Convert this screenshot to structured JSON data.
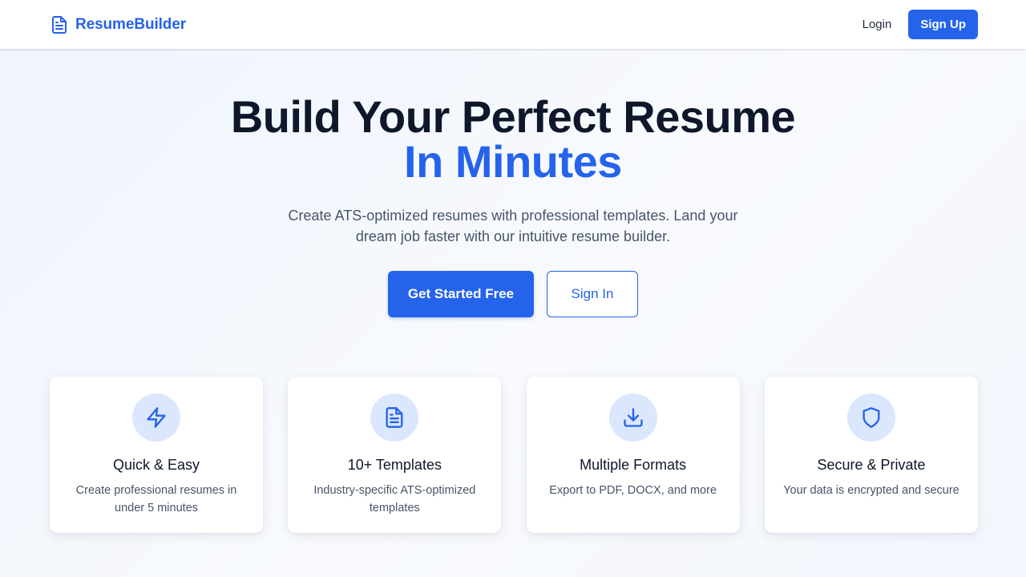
{
  "header": {
    "brand_name": "ResumeBuilder",
    "brand_icon": "document-icon",
    "login_label": "Login",
    "signup_label": "Sign Up"
  },
  "hero": {
    "title_line1": "Build Your Perfect Resume",
    "title_line2": "In Minutes",
    "subtitle": "Create ATS-optimized resumes with professional templates. Land your dream job faster with our intuitive resume builder.",
    "primary_cta": "Get Started Free",
    "secondary_cta": "Sign In"
  },
  "features": [
    {
      "icon": "lightning-icon",
      "title": "Quick & Easy",
      "description": "Create professional resumes in under 5 minutes"
    },
    {
      "icon": "document-icon",
      "title": "10+ Templates",
      "description": "Industry-specific ATS-optimized templates"
    },
    {
      "icon": "download-icon",
      "title": "Multiple Formats",
      "description": "Export to PDF, DOCX, and more"
    },
    {
      "icon": "shield-icon",
      "title": "Secure & Private",
      "description": "Your data is encrypted and secure"
    }
  ],
  "colors": {
    "accent": "#2563eb",
    "icon_bg": "#dbe7fd",
    "text_dark": "#0f172a",
    "text_muted": "#475569"
  }
}
